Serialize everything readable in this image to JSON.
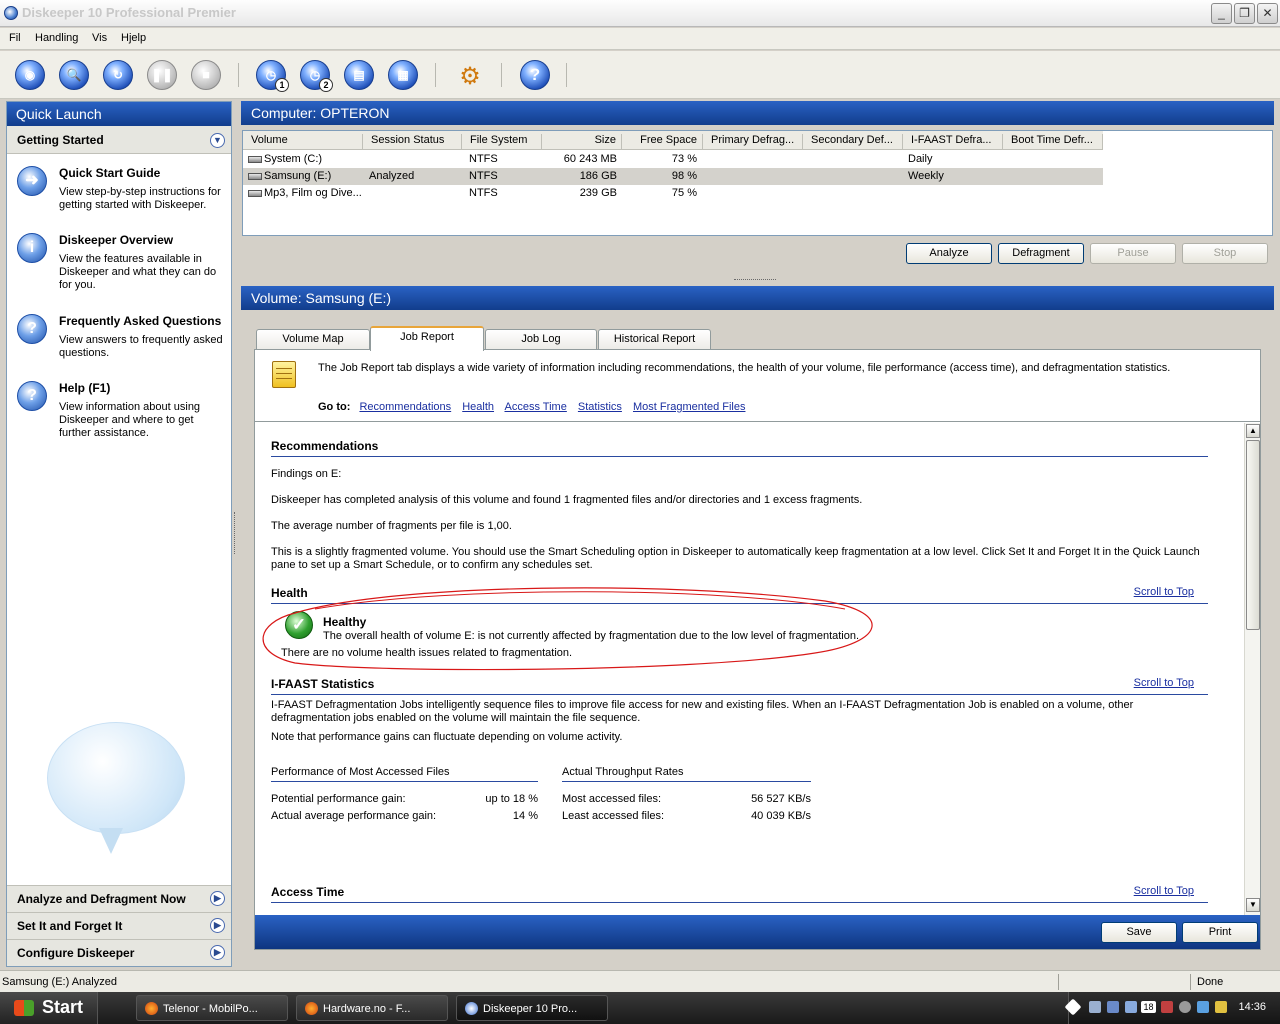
{
  "window": {
    "title": "Diskeeper 10 Professional Premier"
  },
  "menu": [
    "Fil",
    "Handling",
    "Vis",
    "Hjelp"
  ],
  "toolbar": {
    "buttons": [
      "analyze-icon",
      "analyze-report-icon",
      "defragment-icon",
      "pause-icon",
      "stop-icon",
      "job-1-icon",
      "job-2-icon",
      "report-icon",
      "ifaast-icon",
      "settings-icon",
      "help-icon"
    ],
    "badges": {
      "one": "1",
      "two": "2"
    }
  },
  "quick_launch": {
    "title": "Quick Launch",
    "section": "Getting Started",
    "items": [
      {
        "title": "Quick Start Guide",
        "desc": "View step-by-step instructions for getting started with Diskeeper."
      },
      {
        "title": "Diskeeper Overview",
        "desc": "View the features available in Diskeeper and what they can do for you."
      },
      {
        "title": "Frequently Asked Questions",
        "desc": "View answers to frequently asked questions."
      },
      {
        "title": "Help (F1)",
        "desc": "View information about using Diskeeper and where to get further assistance."
      }
    ],
    "bottom_sections": [
      "Analyze and Defragment Now",
      "Set It and Forget It",
      "Configure Diskeeper"
    ]
  },
  "computer": {
    "title": "Computer: OPTERON",
    "columns": [
      "Volume",
      "Session Status",
      "File System",
      "Size",
      "Free Space",
      "Primary Defrag...",
      "Secondary Def...",
      "I-FAAST Defra...",
      "Boot Time Defr..."
    ],
    "rows": [
      {
        "volume": "System (C:)",
        "status": "",
        "fs": "NTFS",
        "size": "60 243 MB",
        "free": "73 %",
        "ifaast": "Daily"
      },
      {
        "volume": "Samsung  (E:)",
        "status": "Analyzed",
        "fs": "NTFS",
        "size": "186 GB",
        "free": "98 %",
        "ifaast": "Weekly"
      },
      {
        "volume": "Mp3, Film og Dive...",
        "status": "",
        "fs": "NTFS",
        "size": "239 GB",
        "free": "75 %",
        "ifaast": ""
      }
    ],
    "buttons": {
      "analyze": "Analyze",
      "defragment": "Defragment",
      "pause": "Pause",
      "stop": "Stop"
    }
  },
  "volume": {
    "title": "Volume: Samsung  (E:)",
    "tabs": [
      "Volume Map",
      "Job Report",
      "Job Log",
      "Historical Report"
    ],
    "info": "The Job Report tab displays a wide variety of information including recommendations, the health of your volume, file performance (access time), and defragmentation statistics.",
    "goto_label": "Go to:",
    "goto_links": [
      "Recommendations",
      "Health",
      "Access Time",
      "Statistics",
      "Most Fragmented Files"
    ],
    "report": {
      "recommendations_title": "Recommendations",
      "findings": "Findings on E:",
      "line1": "Diskeeper has completed analysis of this volume and found 1 fragmented files and/or directories and 1 excess fragments.",
      "line2": "The average number of fragments per file is 1,00.",
      "line3": "This is a slightly fragmented volume. You should use the Smart Scheduling option in Diskeeper to automatically keep fragmentation at a low level. Click Set It and Forget It in the Quick Launch pane to set up a Smart Schedule, or to confirm any schedules set.",
      "health_title": "Health",
      "scroll_to_top": "Scroll to Top",
      "healthy": "Healthy",
      "health_desc": "The overall health of volume E: is not currently affected by fragmentation due to the low level of fragmentation.",
      "health_issues": "There are no volume health issues related to fragmentation.",
      "ifaast_title": "I-FAAST Statistics",
      "ifaast_desc": "I-FAAST Defragmentation Jobs intelligently sequence files to improve file access for new and existing files. When an I-FAAST Defragmentation Job is enabled on a volume, other defragmentation jobs enabled on the volume will maintain the file sequence.",
      "ifaast_note": "Note that performance gains can fluctuate depending on volume activity.",
      "perf_title": "Performance of Most Accessed Files",
      "perf_rows": [
        {
          "label": "Potential performance gain:",
          "value": "up to 18 %"
        },
        {
          "label": "Actual average performance gain:",
          "value": "14 %"
        }
      ],
      "throughput_title": "Actual Throughput Rates",
      "throughput_rows": [
        {
          "label": "Most accessed files:",
          "value": "56 527 KB/s"
        },
        {
          "label": "Least accessed files:",
          "value": "40 039 KB/s"
        }
      ],
      "access_title": "Access Time"
    },
    "buttons": {
      "save": "Save",
      "print": "Print"
    }
  },
  "status": {
    "left": "Samsung  (E:) Analyzed",
    "right": "Done"
  },
  "taskbar": {
    "start": "Start",
    "tasks": [
      "Telenor - MobilPo...",
      "Hardware.no - F...",
      "Diskeeper 10 Pro..."
    ],
    "clock": "14:36",
    "tray_badge": "18"
  },
  "colors": {
    "header_blue": "#1f4fa8",
    "annotation_red": "#d81818",
    "link": "#1a2fa0"
  }
}
